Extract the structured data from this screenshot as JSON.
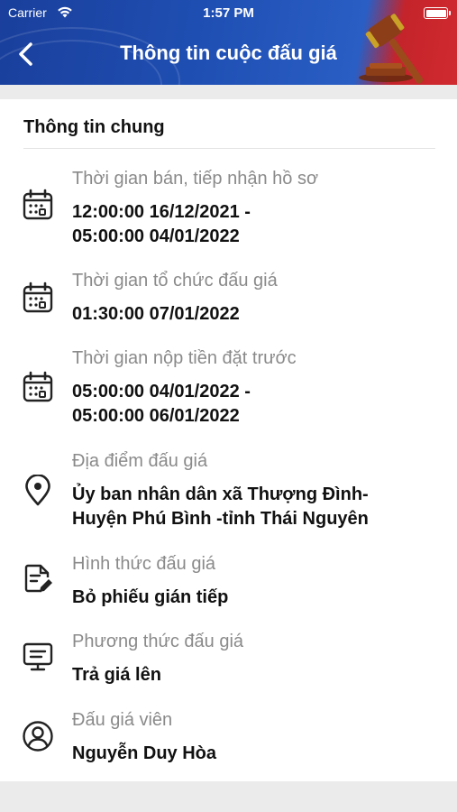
{
  "status_bar": {
    "carrier": "Carrier",
    "time": "1:57 PM"
  },
  "header": {
    "title": "Thông tin cuộc đấu giá",
    "back_icon": "chevron-left-icon",
    "decoration_icon": "gavel-icon"
  },
  "section": {
    "title": "Thông tin chung"
  },
  "items": [
    {
      "icon": "calendar-icon",
      "label": "Thời gian bán, tiếp nhận hồ sơ",
      "value_line1": "12:00:00 16/12/2021 -",
      "value_line2": "05:00:00 04/01/2022"
    },
    {
      "icon": "calendar-icon",
      "label": "Thời gian tổ chức đấu giá",
      "value_line1": "01:30:00 07/01/2022"
    },
    {
      "icon": "calendar-icon",
      "label": "Thời gian nộp tiền đặt trước",
      "value_line1": "05:00:00 04/01/2022 -",
      "value_line2": "05:00:00 06/01/2022"
    },
    {
      "icon": "location-pin-icon",
      "label": "Địa điểm đấu giá",
      "value_line1": "Ủy ban nhân dân xã Thượng Đình-",
      "value_line2": "Huyện Phú Bình -tỉnh Thái Nguyên"
    },
    {
      "icon": "document-edit-icon",
      "label": "Hình thức đấu giá",
      "value_line1": "Bỏ phiếu gián tiếp"
    },
    {
      "icon": "monitor-icon",
      "label": "Phương thức đấu giá",
      "value_line1": "Trả giá lên"
    },
    {
      "icon": "user-circle-icon",
      "label": "Đấu giá viên",
      "value_line1": "Nguyễn Duy Hòa"
    }
  ],
  "colors": {
    "header_blue": "#1f4fb3",
    "header_red": "#d02a2f",
    "label_gray": "#8a8a8a"
  }
}
